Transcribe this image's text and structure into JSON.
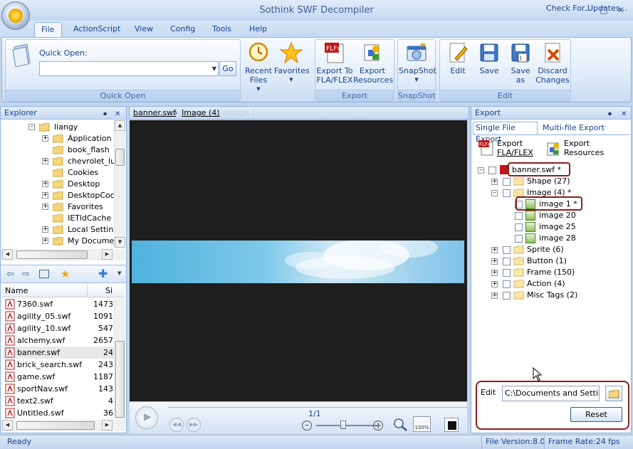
{
  "window": {
    "title": "Sothink SWF Decompiler"
  },
  "menu_tabs": [
    {
      "label": "File"
    },
    {
      "label": "ActionScript"
    },
    {
      "label": "View"
    },
    {
      "label": "Config"
    },
    {
      "label": "Tools"
    },
    {
      "label": "Help"
    }
  ],
  "check_updates": "Check For Updates...",
  "ribbon": {
    "quick_open": {
      "label": "Quick Open:",
      "value": "",
      "go": "Go",
      "group": "Quick Open"
    },
    "recent_files": "Recent Files",
    "favorites": "Favorites",
    "export_fla": "Export To FLA/FLEX",
    "export_res": "Export Resources",
    "export_group": "Export",
    "snapshot": "SnapShot",
    "snapshot_group": "SnapShot",
    "edit": "Edit",
    "save": "Save",
    "save_as": "Save as",
    "discard": "Discard Changes",
    "edit_group": "Edit"
  },
  "explorer": {
    "title": "Explorer",
    "root": "liangy",
    "folders": [
      {
        "label": "Application Da",
        "expand": true
      },
      {
        "label": "book_flash",
        "expand": false
      },
      {
        "label": "chevrolet_lut",
        "expand": true
      },
      {
        "label": "Cookies",
        "expand": false
      },
      {
        "label": "Desktop",
        "expand": true
      },
      {
        "label": "DesktopCocky",
        "expand": true
      },
      {
        "label": "Favorites",
        "expand": true
      },
      {
        "label": "IETldCache",
        "expand": false
      },
      {
        "label": "Local Settings",
        "expand": true
      },
      {
        "label": "My Documents",
        "expand": true
      }
    ],
    "columns": {
      "name": "Name",
      "size": "Si"
    },
    "files": [
      {
        "name": "7360.swf",
        "size": "1473"
      },
      {
        "name": "agility_05.swf",
        "size": "1091"
      },
      {
        "name": "agility_10.swf",
        "size": "547"
      },
      {
        "name": "alchemy.swf",
        "size": "2657"
      },
      {
        "name": "banner.swf",
        "size": "24"
      },
      {
        "name": "brick_search.swf",
        "size": "243"
      },
      {
        "name": "game.swf",
        "size": "1187"
      },
      {
        "name": "sportNav.swf",
        "size": "143"
      },
      {
        "name": "text2.swf",
        "size": "4"
      },
      {
        "name": "Untitled.swf",
        "size": "36"
      }
    ]
  },
  "breadcrumb": {
    "file": "banner.swf",
    "category": "Image (4)",
    "item": "image 1"
  },
  "player": {
    "frame_counter": "1/1"
  },
  "export_panel": {
    "title": "Export",
    "tabs": [
      "Single File Export",
      "Multi-file Export"
    ],
    "btn_fla_line1": "Export",
    "btn_fla_line2": "FLA/FLEX",
    "btn_res_line1": "Export",
    "btn_res_line2": "Resources",
    "root": "banner.swf *",
    "nodes": [
      {
        "label": "Shape (27)"
      },
      {
        "label": "Image (4) *"
      },
      {
        "label": "image 1 *"
      },
      {
        "label": "image 20"
      },
      {
        "label": "image 25"
      },
      {
        "label": "image 28"
      },
      {
        "label": "Sprite (6)"
      },
      {
        "label": "Button (1)"
      },
      {
        "label": "Frame (150)"
      },
      {
        "label": "Action (4)"
      },
      {
        "label": "Misc Tags (2)"
      }
    ],
    "edit_label": "Edit",
    "edit_path": "C:\\Documents and Settings",
    "reset": "Reset"
  },
  "status": {
    "state": "Ready",
    "file_version": "File Version:8.0",
    "frame_rate": "Frame Rate:24 fps"
  }
}
